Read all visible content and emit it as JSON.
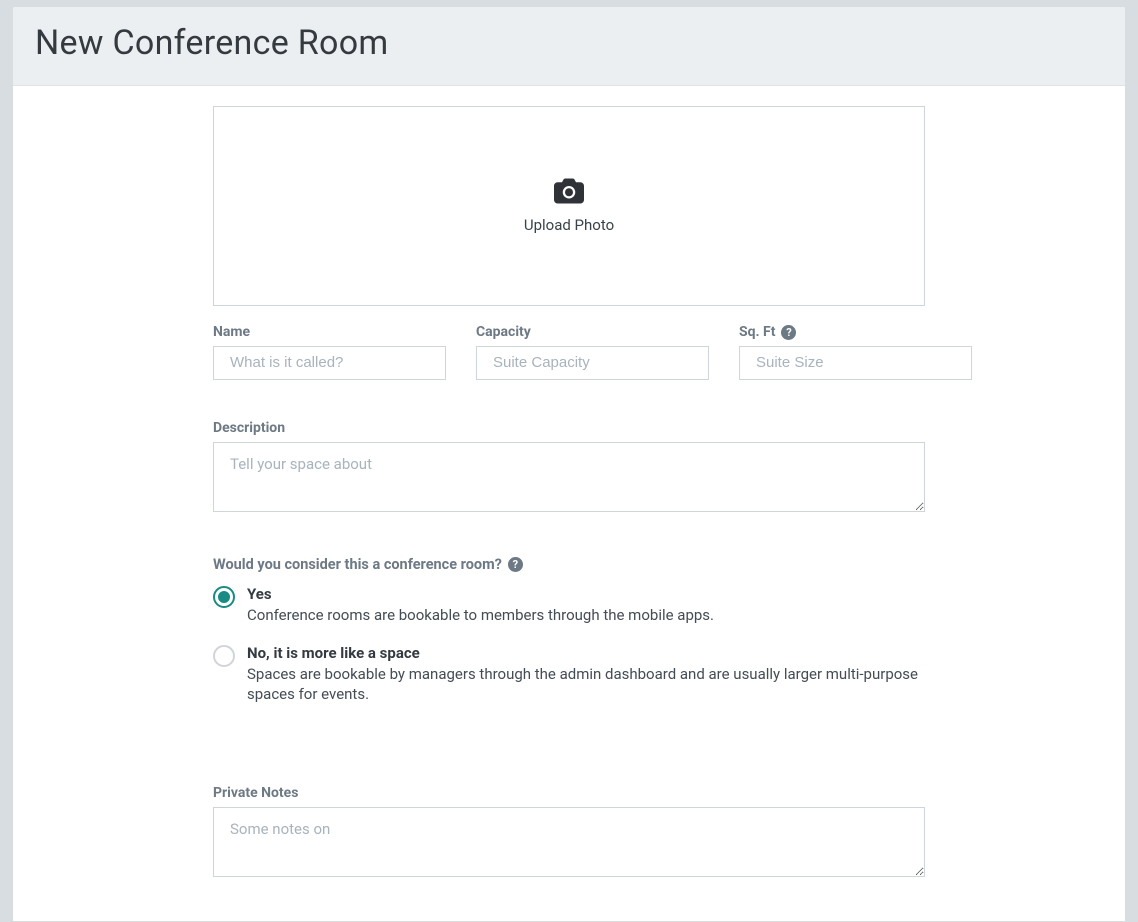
{
  "page": {
    "title": "New Conference Room"
  },
  "upload": {
    "label": "Upload Photo"
  },
  "fields": {
    "name": {
      "label": "Name",
      "placeholder": "What is it called?",
      "value": ""
    },
    "capacity": {
      "label": "Capacity",
      "placeholder": "Suite Capacity",
      "value": ""
    },
    "sqft": {
      "label": "Sq. Ft",
      "placeholder": "Suite Size",
      "value": ""
    }
  },
  "description": {
    "label": "Description",
    "placeholder": "Tell your space about",
    "value": ""
  },
  "conference_question": {
    "label": "Would you consider this a conference room?",
    "help_glyph": "?",
    "options": {
      "yes": {
        "title": "Yes",
        "desc": "Conference rooms are bookable to members through the mobile apps.",
        "checked": true
      },
      "no": {
        "title": "No, it is more like a space",
        "desc": "Spaces are bookable by managers through the admin dashboard and are usually larger multi-purpose spaces for events.",
        "checked": false
      }
    }
  },
  "private_notes": {
    "label": "Private Notes",
    "placeholder": "Some notes on",
    "value": ""
  }
}
